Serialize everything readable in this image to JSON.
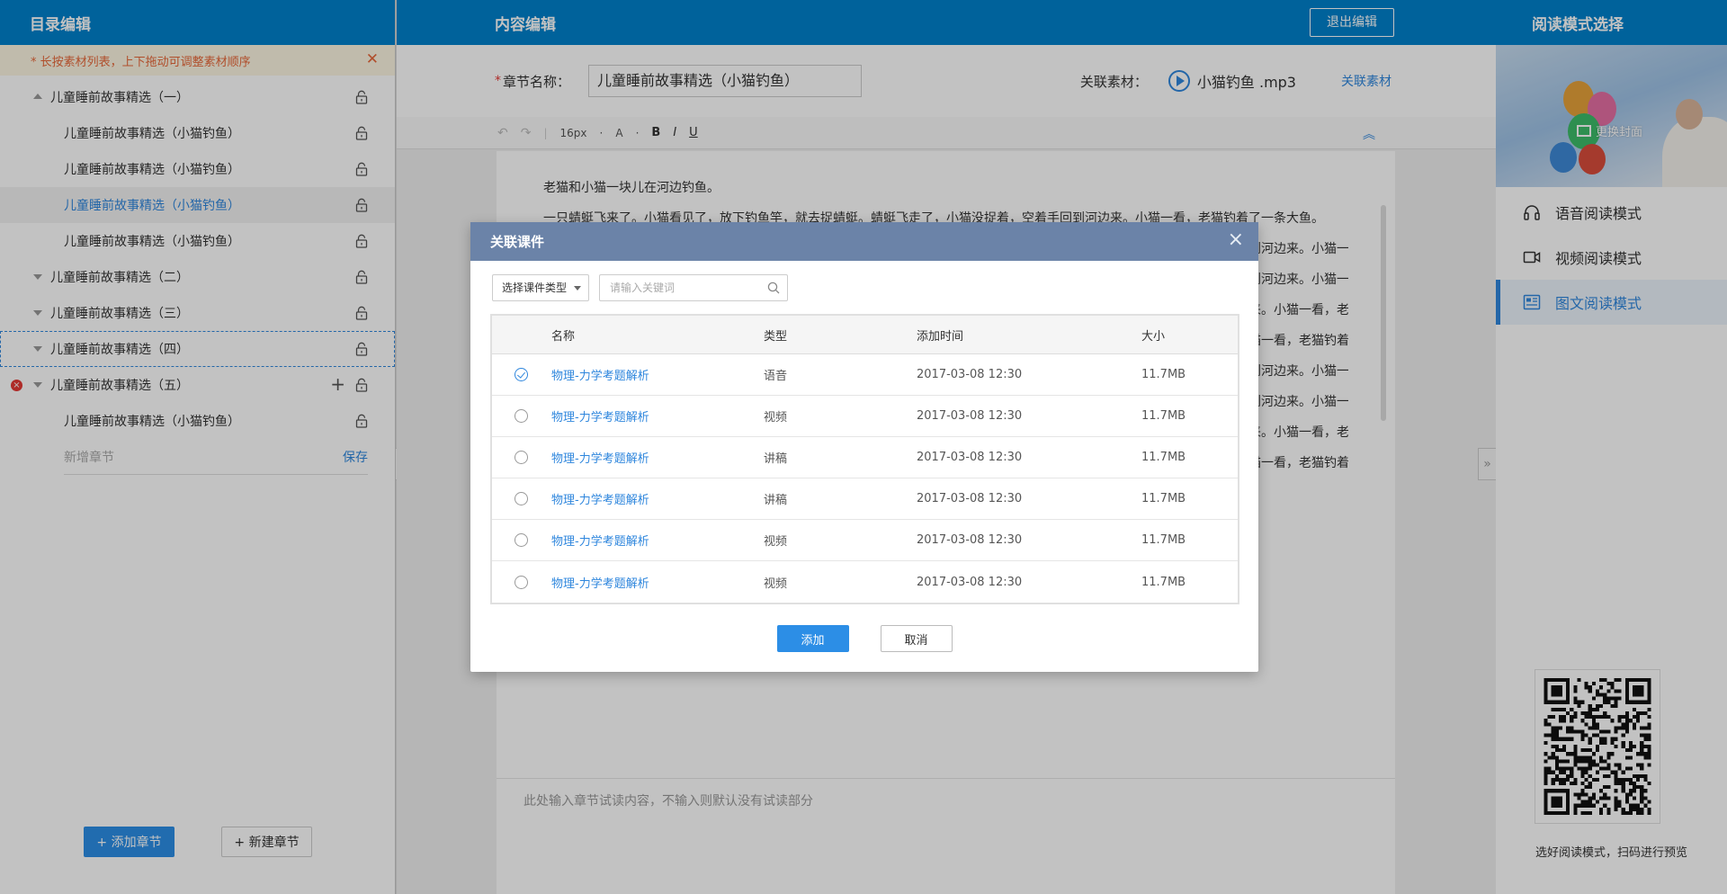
{
  "left": {
    "title": "目录编辑",
    "tip": "* 长按素材列表，上下拖动可调整素材顺序",
    "tree": [
      {
        "label": "儿童睡前故事精选（一）",
        "level": 1,
        "caret": "up"
      },
      {
        "label": "儿童睡前故事精选（小猫钓鱼）",
        "level": 2
      },
      {
        "label": "儿童睡前故事精选（小猫钓鱼）",
        "level": 2
      },
      {
        "label": "儿童睡前故事精选（小猫钓鱼）",
        "level": 2,
        "active": true
      },
      {
        "label": "儿童睡前故事精选（小猫钓鱼）",
        "level": 2
      },
      {
        "label": "儿童睡前故事精选（二）",
        "level": 1,
        "caret": "down"
      },
      {
        "label": "儿童睡前故事精选（三）",
        "level": 1,
        "caret": "down"
      },
      {
        "label": "儿童睡前故事精选（四）",
        "level": 1,
        "caret": "down",
        "dashed": true
      },
      {
        "label": "儿童睡前故事精选（五）",
        "level": 1,
        "caret": "down",
        "deletable": true,
        "addable": true
      },
      {
        "label": "儿童睡前故事精选（小猫钓鱼）",
        "level": 2
      }
    ],
    "new_chapter_placeholder": "新增章节",
    "new_chapter_save": "保存",
    "add_chapter_button": "+ 添加章节",
    "new_section_button": "+ 新建章节",
    "fold_glyph": "«"
  },
  "center": {
    "title": "内容编辑",
    "exit_button": "退出编辑",
    "chapter_label": "章节名称：",
    "chapter_value": "儿童睡前故事精选（小猫钓鱼）",
    "related_label": "关联素材：",
    "related_file": "小猫钓鱼 .mp3",
    "related_link": "关联素材",
    "toolbar": {
      "undo": "↶",
      "redo": "↷",
      "font_size": "16px",
      "font_color": "A",
      "bold": "B",
      "italic": "I",
      "underline": "U",
      "collapse": "︽"
    },
    "paragraphs": [
      "老猫和小猫一块儿在河边钓鱼。",
      "一只蜻蜓飞来了。小猫看见了，放下钓鱼竿，就去捉蜻蜓。蜻蜓飞走了，小猫没捉着，空着手回到河边来。小猫一看，老猫钓着了一条大鱼。",
      "老猫和小猫一块儿在河边钓鱼。一只蜻蜓飞来了。小猫看见了，放下钓鱼竿，就去捉蜻蜓。蜻蜓飞走了，小猫没捉着，空着手回到河边来。小猫一看，老猫钓着了一条大鱼，",
      "老猫和小猫一块儿在河边钓鱼。一只蜻蜓飞来了。小猫看见了，放下钓鱼竿，就去捉蜻蜓。蜻蜓飞走了，小猫没捉着，空着手回到河边来。小猫一看，老猫钓着了一条大鱼老猫和",
      "小猫一块儿在河边钓鱼。一只蜻蜓飞来了。小猫看见了，放下钓鱼竿，就去捉蜻蜓。蜻蜓飞走了，小猫没捉着，空着手回到河边来。小猫一看，老猫钓着了一条大鱼。小猫一看，老猫",
      "钓着了一条大鱼。一只蜻蜓飞来了。小猫看见了，放下钓鱼竿，就去捉蜻蜓。蜻蜓飞走了，小猫没捉着，空着手回到河边来。小猫一看，老猫钓着了一条大鱼。小猫一看，老猫又钓着",
      "老猫和小猫一块儿在河边钓鱼。一只蜻蜓飞来了。小猫看见了，放下钓鱼竿，就去捉蜻蜓。蜻蜓飞走了，小猫没捉着，空着手回到河边来。小猫一看，老猫钓着了一条大鱼，",
      "老猫和小猫一块儿在河边钓鱼。一只蜻蜓飞来了。小猫看见了，放下钓鱼竿，就去捉蜻蜓。蜻蜓飞走了，小猫没捉着，空着手回到河边来。小猫一看，老猫钓着了一条大鱼老猫和",
      "小猫一块儿在河边钓鱼。一只蜻蜓飞来了。小猫看见了，放下钓鱼竿，就去捉蜻蜓。蜻蜓飞走了，小猫没捉着，空着手回到河边来。小猫一看，老猫钓着了一条大鱼。小猫一看，老猫",
      "钓着了一条大鱼。一只蜻蜓飞来了。小猫看见了，放下钓鱼竿，就去捉蜻蜓。蜻蜓飞走了，小猫没捉着，空着手回到河边来。小猫一看，老猫钓着了一条大鱼。小猫一看，老猫又钓着"
    ],
    "trial_placeholder": "此处输入章节试读内容，不输入则默认没有试读部分"
  },
  "right": {
    "title": "阅读模式选择",
    "change_cover": "更换封面",
    "modes": [
      {
        "label": "语音阅读模式",
        "icon": "headphones-icon"
      },
      {
        "label": "视频阅读模式",
        "icon": "video-icon"
      },
      {
        "label": "图文阅读模式",
        "icon": "image-text-icon",
        "active": true
      }
    ],
    "qr_caption": "选好阅读模式，扫码进行预览",
    "fold_glyph": "»"
  },
  "modal": {
    "title": "关联课件",
    "close": "×",
    "type_select": "选择课件类型",
    "search_placeholder": "请输入关键词",
    "columns": [
      "名称",
      "类型",
      "添加时间",
      "大小"
    ],
    "rows": [
      {
        "name": "物理-力学考题解析",
        "type": "语音",
        "time": "2017-03-08  12:30",
        "size": "11.7MB",
        "checked": true
      },
      {
        "name": "物理-力学考题解析",
        "type": "视频",
        "time": "2017-03-08  12:30",
        "size": "11.7MB",
        "checked": false
      },
      {
        "name": "物理-力学考题解析",
        "type": "讲稿",
        "time": "2017-03-08  12:30",
        "size": "11.7MB",
        "checked": false
      },
      {
        "name": "物理-力学考题解析",
        "type": "讲稿",
        "time": "2017-03-08  12:30",
        "size": "11.7MB",
        "checked": false
      },
      {
        "name": "物理-力学考题解析",
        "type": "视频",
        "time": "2017-03-08  12:30",
        "size": "11.7MB",
        "checked": false
      },
      {
        "name": "物理-力学考题解析",
        "type": "视频",
        "time": "2017-03-08  12:30",
        "size": "11.7MB",
        "checked": false
      }
    ],
    "confirm": "添加",
    "cancel": "取消"
  },
  "colors": {
    "header_blue": "#0081cc",
    "modal_header": "#6b83a8",
    "link_blue": "#2e86dd",
    "primary_button": "#2c8ee6",
    "warning_text": "#e8683a"
  }
}
